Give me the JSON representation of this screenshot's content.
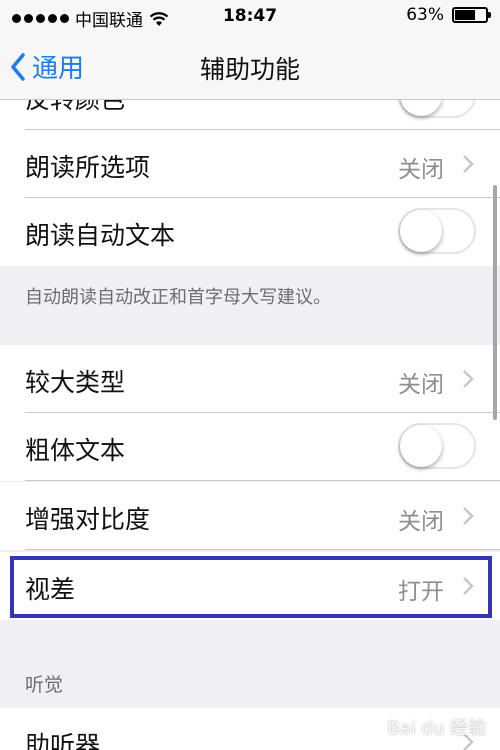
{
  "status_bar": {
    "carrier": "中国联通",
    "time": "18:47",
    "battery_percent": "63%",
    "battery_level": 0.63
  },
  "nav": {
    "back_label": "通用",
    "title": "辅助功能"
  },
  "rows": {
    "invert_colors": {
      "label": "反转颜色",
      "toggle_on": false
    },
    "speak_selection": {
      "label": "朗读所选项",
      "value": "关闭"
    },
    "speak_auto_text": {
      "label": "朗读自动文本",
      "toggle_on": false
    },
    "speak_auto_text_footer": "自动朗读自动改正和首字母大写建议。",
    "larger_type": {
      "label": "较大类型",
      "value": "关闭"
    },
    "bold_text": {
      "label": "粗体文本",
      "toggle_on": false
    },
    "increase_contrast": {
      "label": "增强对比度",
      "value": "关闭"
    },
    "parallax": {
      "label": "视差",
      "value": "打开"
    },
    "hearing_header": "听觉",
    "hearing_aids": {
      "label": "助听器"
    }
  },
  "watermark": "Bai du 经验",
  "colors": {
    "accent": "#1a7cf6",
    "highlight_border": "#3335b5",
    "group_background": "#efeff4"
  }
}
